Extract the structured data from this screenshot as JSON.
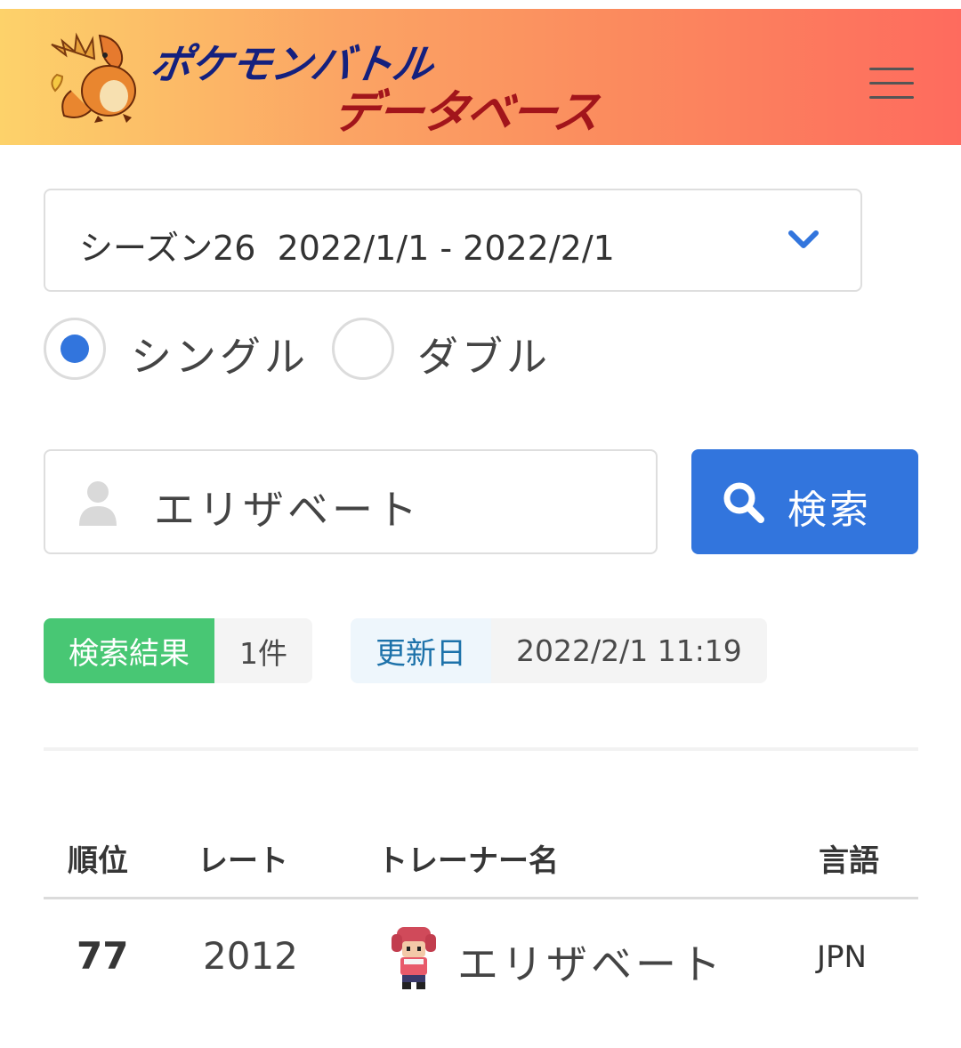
{
  "header": {
    "logo_line1": "ポケモンバトル",
    "logo_line2": "データベース",
    "menu_icon": "hamburger-icon",
    "colors": {
      "gradient_start": "#fdd26a",
      "gradient_end": "#fe6b5e"
    }
  },
  "season": {
    "selected": "シーズン26  2022/1/1 - 2022/2/1",
    "icon": "chevron-down-icon"
  },
  "battle_type": {
    "options": [
      {
        "label": "シングル",
        "selected": true
      },
      {
        "label": "ダブル",
        "selected": false
      }
    ]
  },
  "search": {
    "value": "エリザベート",
    "user_icon": "user-icon",
    "button_label": "検索",
    "button_icon": "search-icon",
    "accent": "#3275dd"
  },
  "tags": {
    "results_label": "検索結果",
    "results_value": "1件",
    "updated_label": "更新日",
    "updated_value": "2022/2/1 11:19"
  },
  "table": {
    "headers": {
      "rank": "順位",
      "rate": "レート",
      "trainer": "トレーナー名",
      "lang": "言語"
    },
    "rows": [
      {
        "rank": "77",
        "rate": "2012",
        "trainer": "エリザベート",
        "lang": "JPN"
      }
    ]
  }
}
